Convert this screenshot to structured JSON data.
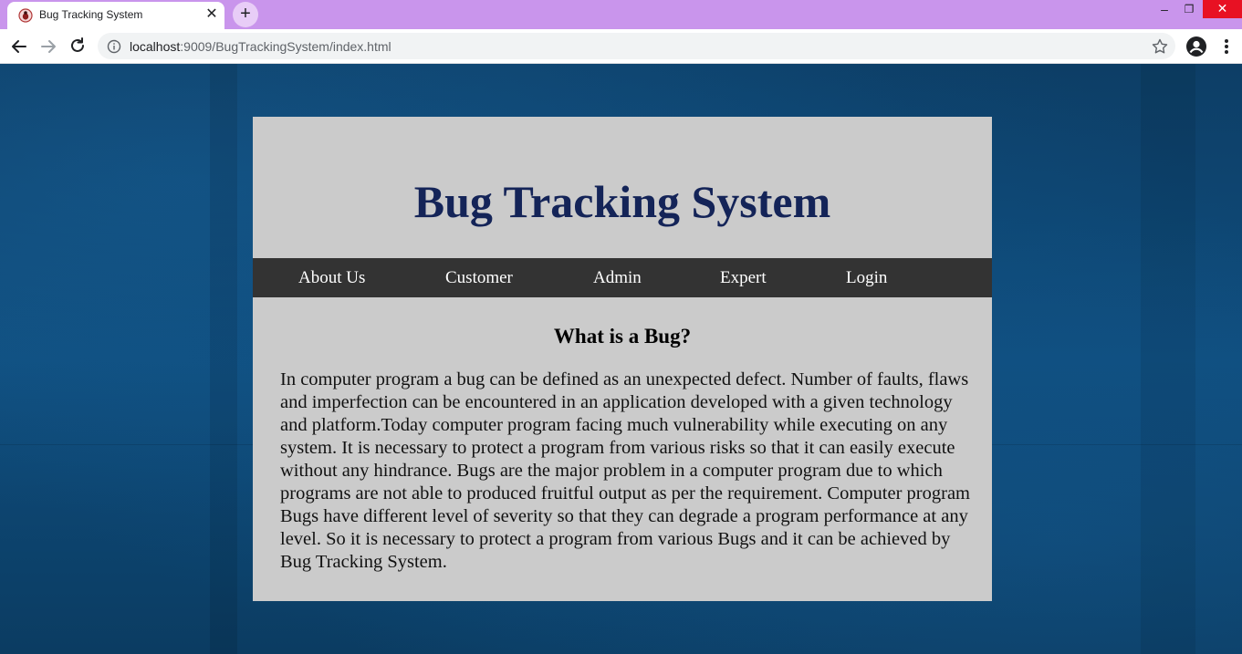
{
  "browser": {
    "tab_title": "Bug Tracking System",
    "tab_close_glyph": "✕",
    "new_tab_glyph": "+",
    "url_host": "localhost",
    "url_rest": ":9009/BugTrackingSystem/index.html",
    "window_controls": {
      "minimize": "–",
      "restore": "❐",
      "close": "✕"
    },
    "colors": {
      "tab_strip": "#c995ec",
      "close_button": "#e81123"
    },
    "icons": [
      "favicon-icon",
      "back-arrow-icon",
      "forward-arrow-icon",
      "reload-icon",
      "info-icon",
      "star-icon",
      "profile-icon",
      "kebab-menu-icon"
    ]
  },
  "page": {
    "title": "Bug Tracking System",
    "nav": {
      "about": "About Us",
      "customer": "Customer",
      "admin": "Admin",
      "expert": "Expert",
      "login": "Login"
    },
    "section_heading": "What is a Bug?",
    "body": "In computer program a bug can be defined as an unexpected defect. Number of faults, flaws and imperfection can be encountered in an application developed with a given technology and platform.Today computer program facing much vulnerability while executing on any system. It is necessary to protect a program from various risks so that it can easily execute without any hindrance. Bugs are the major problem in a computer program due to which programs are not able to produced fruitful output as per the requirement. Computer program Bugs have different level of severity so that they can degrade a program performance at any level. So it is necessary to protect a program from various Bugs and it can be achieved by Bug Tracking System.",
    "colors": {
      "title": "#142458",
      "navbar": "#333333",
      "card": "#cbcbcb",
      "background": "#0b3f66"
    }
  }
}
